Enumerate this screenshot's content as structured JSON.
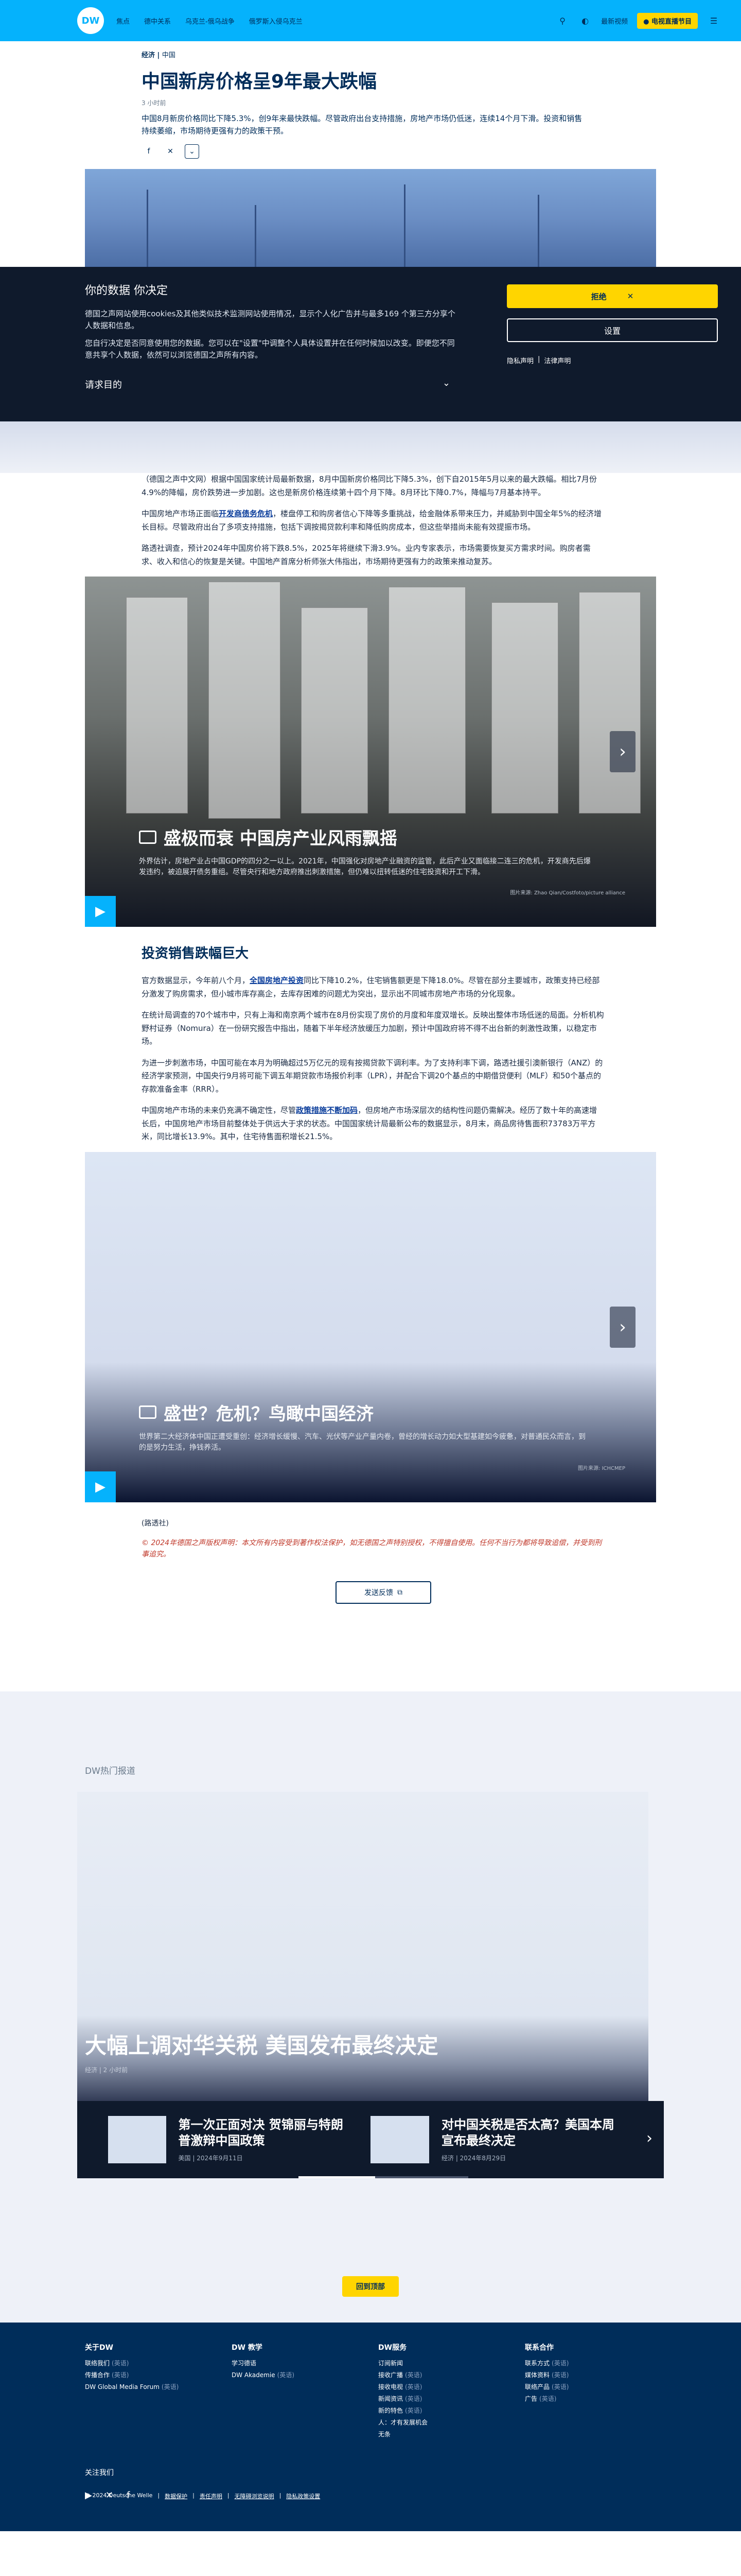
{
  "header": {
    "logo": "DW",
    "nav": [
      "焦点",
      "德中关系",
      "乌克兰-俄乌战争",
      "俄罗斯入侵乌克兰"
    ],
    "latest_label": "最新视频",
    "live_label": "电视直播节目"
  },
  "article": {
    "category": "经济",
    "subcategory": "中国",
    "title": "中国新房价格呈9年最大跌幅",
    "date": "3 小时前",
    "lead": "中国8月新房价格同比下降5.3%，创9年来最快跌幅。尽管政府出台支持措施，房地产市场仍低迷，连续14个月下滑。投资和销售持续萎缩，市场期待更强有力的政策干预。"
  },
  "cookie": {
    "heading": "你的数据 你决定",
    "para1": "德国之声网站使用cookies及其他类似技术监测网站使用情况，显示个人化广告并与最多169 个第三方分享个人数据和信息。",
    "para2": "您自行决定是否同意使用您的数据。您可以在\"设置\"中调整个人具体设置并在任何时候加以改变。即便您不同意共享个人数据，依然可以浏览德国之声所有内容。",
    "purpose_label": "请求目的",
    "reject_label": "拒绝",
    "settings_label": "设置",
    "privacy_link": "隐私声明",
    "legal_link": "法律声明"
  },
  "body": {
    "p1": "（德国之声中文网）根据中国国家统计局最新数据，8月中国新房价格同比下降5.3%，创下自2015年5月以来的最大跌幅。相比7月份4.9%的降幅，房价跌势进一步加剧。这也是新房价格连续第十四个月下降。8月环比下降0.7%，降幅与7月基本持平。",
    "p2_pre": "中国房地产市场正面临",
    "p2_link": "开发商债务危机",
    "p2_post": "，楼盘停工和购房者信心下降等多重挑战，给金融体系带来压力，并威胁到中国全年5%的经济增长目标。尽管政府出台了多项支持措施，包括下调按揭贷款利率和降低购房成本，但这些举措尚未能有效提振市场。",
    "p3": "路透社调查，预计2024年中国房价将下跌8.5%，2025年将继续下滑3.9%。业内专家表示，市场需要恢复买方需求时间。购房者需求、收入和信心的恢复是关键。中国地产首席分析师张大伟指出，市场期待更强有力的政策来推动复苏。",
    "gallery1": {
      "caption": "盛极而衰 中国房产业风雨飘摇",
      "desc": "外界估计，房地产业占中国GDP的四分之一以上。2021年，中国强化对房地产业融资的监管，此后产业又面临接二连三的危机，开发商先后爆发违约，被迫展开债务重组。尽管央行和地方政府推出刺激措施，但仍难以扭转低迷的住宅投资和开工下滑。",
      "credit": "图片来源: Zhao Qian/Costfoto/picture alliance"
    },
    "section2": "投资销售跌幅巨大",
    "p4_pre": "官方数据显示，今年前八个月，",
    "p4_link": "全国房地产投资",
    "p4_post": "同比下降10.2%，住宅销售额更是下降18.0%。尽管在部分主要城市，政策支持已经部分激发了购房需求，但小城市库存高企，去库存困难的问题尤为突出，显示出不同城市房地产市场的分化现象。",
    "p5": "在统计局调查的70个城市中，只有上海和南京两个城市在8月份实现了房价的月度和年度双增长。反映出整体市场低迷的局面。分析机构野村证券（Nomura）在一份研究报告中指出，随着下半年经济放缓压力加剧，预计中国政府将不得不出台新的刺激性政策，以稳定市场。",
    "p6": "为进一步刺激市场，中国可能在本月为明确超过5万亿元的现有按揭贷款下调利率。为了支持利率下调，路透社援引澳新银行（ANZ）的经济学家预测，中国央行9月将可能下调五年期贷款市场报价利率（LPR），并配合下调20个基点的中期借贷便利（MLF）和50个基点的存款准备金率（RRR）。",
    "p7_pre": "中国房地产市场的未来仍充满不确定性，尽管",
    "p7_link": "政策措施不断加码",
    "p7_post": "，但房地产市场深层次的结构性问题仍需解决。经历了数十年的高速增长后，中国房地产市场目前整体处于供远大于求的状态。中国国家统计局最新公布的数据显示，8月末，商品房待售面积73783万平方米，同比增长13.9%。其中，住宅待售面积增长21.5%。",
    "gallery2": {
      "caption": "盛世？危机？鸟瞰中国经济",
      "desc": "世界第二大经济体中国正遭受重创：经济增长缓慢、汽车、光伏等产业产量内卷，曾经的增长动力如大型基建如今疲惫，对普通民众而言，到的是努力生活，挣钱养活。",
      "credit": "图片来源: ICHCMEP"
    },
    "source": "(路透社)",
    "copyright": "© 2024年德国之声版权声明：本文所有内容受到著作权法保护，如无德国之声特别授权，不得擅自使用。任何不当行为都将导致追偿，并受到刑事追究。",
    "send_label": "发送反馈"
  },
  "hot": {
    "title": "DW热门报道",
    "hero_title": "大幅上调对华关税 美国发布最终决定",
    "hero_meta": "经济 | 2 小时前",
    "teasers": [
      {
        "title": "第一次正面对决 贺锦丽与特朗普激辩中国政策",
        "meta": "美国 | 2024年9月11日"
      },
      {
        "title": "对中国关税是否太高？美国本周宣布最终决定",
        "meta": "经济 | 2024年8月29日"
      }
    ],
    "back_top": "回到顶部"
  },
  "footer": {
    "cols": [
      {
        "title": "关于DW",
        "items": [
          {
            "t": "联络我们",
            "s": "(英语)"
          },
          {
            "t": "传播合作",
            "s": "(英语)"
          },
          {
            "t": "DW Global Media Forum",
            "s": "(英语)"
          }
        ]
      },
      {
        "title": "DW 教学",
        "items": [
          {
            "t": "学习德语",
            "s": ""
          },
          {
            "t": "DW Akademie",
            "s": "(英语)"
          }
        ]
      },
      {
        "title": "DW服务",
        "items": [
          {
            "t": "订阅新闻",
            "s": ""
          },
          {
            "t": "接收广播",
            "s": "(英语)"
          },
          {
            "t": "接收电视",
            "s": "(英语)"
          },
          {
            "t": "新闻资讯",
            "s": "(英语)"
          },
          {
            "t": "新的特色",
            "s": "(英语)"
          },
          {
            "t": "人：才有发展机会",
            "s": ""
          },
          {
            "t": "无条",
            "s": ""
          }
        ]
      },
      {
        "title": "联系合作",
        "items": [
          {
            "t": "联系方式",
            "s": "(英语)"
          },
          {
            "t": "媒体资料",
            "s": "(英语)"
          },
          {
            "t": "联络产品",
            "s": "(英语)"
          },
          {
            "t": "广告",
            "s": "(英语)"
          }
        ]
      }
    ],
    "follow": "关注我们",
    "legal": [
      "© 2024 Deutsche Welle",
      "数据保护",
      "责任声明",
      "无障碍浏览说明",
      "隐私政策设置"
    ]
  }
}
